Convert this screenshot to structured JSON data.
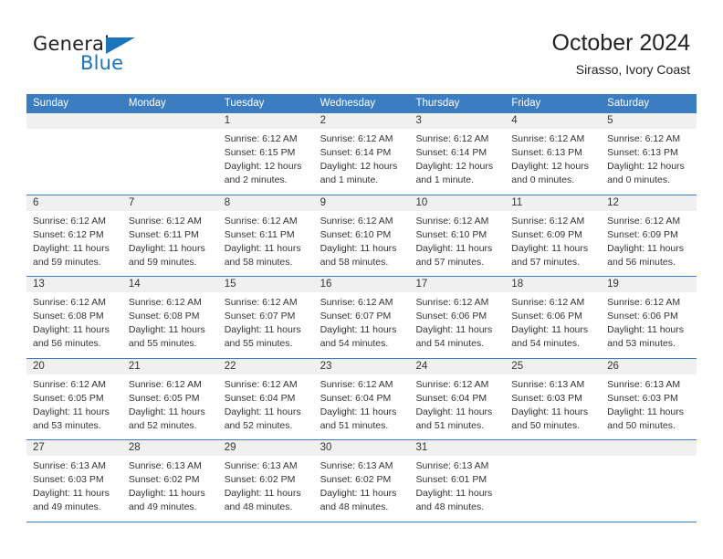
{
  "brand": {
    "name_part1": "General",
    "name_part2": "Blue",
    "accent_color": "#1b75bb"
  },
  "header": {
    "title": "October 2024",
    "subtitle": "Sirasso, Ivory Coast"
  },
  "calendar": {
    "header_bg": "#3b7dc0",
    "weekdays": [
      "Sunday",
      "Monday",
      "Tuesday",
      "Wednesday",
      "Thursday",
      "Friday",
      "Saturday"
    ],
    "weeks": [
      [
        {
          "day": "",
          "sunrise": "",
          "sunset": "",
          "daylight": ""
        },
        {
          "day": "",
          "sunrise": "",
          "sunset": "",
          "daylight": ""
        },
        {
          "day": "1",
          "sunrise": "Sunrise: 6:12 AM",
          "sunset": "Sunset: 6:15 PM",
          "daylight": "Daylight: 12 hours and 2 minutes."
        },
        {
          "day": "2",
          "sunrise": "Sunrise: 6:12 AM",
          "sunset": "Sunset: 6:14 PM",
          "daylight": "Daylight: 12 hours and 1 minute."
        },
        {
          "day": "3",
          "sunrise": "Sunrise: 6:12 AM",
          "sunset": "Sunset: 6:14 PM",
          "daylight": "Daylight: 12 hours and 1 minute."
        },
        {
          "day": "4",
          "sunrise": "Sunrise: 6:12 AM",
          "sunset": "Sunset: 6:13 PM",
          "daylight": "Daylight: 12 hours and 0 minutes."
        },
        {
          "day": "5",
          "sunrise": "Sunrise: 6:12 AM",
          "sunset": "Sunset: 6:13 PM",
          "daylight": "Daylight: 12 hours and 0 minutes."
        }
      ],
      [
        {
          "day": "6",
          "sunrise": "Sunrise: 6:12 AM",
          "sunset": "Sunset: 6:12 PM",
          "daylight": "Daylight: 11 hours and 59 minutes."
        },
        {
          "day": "7",
          "sunrise": "Sunrise: 6:12 AM",
          "sunset": "Sunset: 6:11 PM",
          "daylight": "Daylight: 11 hours and 59 minutes."
        },
        {
          "day": "8",
          "sunrise": "Sunrise: 6:12 AM",
          "sunset": "Sunset: 6:11 PM",
          "daylight": "Daylight: 11 hours and 58 minutes."
        },
        {
          "day": "9",
          "sunrise": "Sunrise: 6:12 AM",
          "sunset": "Sunset: 6:10 PM",
          "daylight": "Daylight: 11 hours and 58 minutes."
        },
        {
          "day": "10",
          "sunrise": "Sunrise: 6:12 AM",
          "sunset": "Sunset: 6:10 PM",
          "daylight": "Daylight: 11 hours and 57 minutes."
        },
        {
          "day": "11",
          "sunrise": "Sunrise: 6:12 AM",
          "sunset": "Sunset: 6:09 PM",
          "daylight": "Daylight: 11 hours and 57 minutes."
        },
        {
          "day": "12",
          "sunrise": "Sunrise: 6:12 AM",
          "sunset": "Sunset: 6:09 PM",
          "daylight": "Daylight: 11 hours and 56 minutes."
        }
      ],
      [
        {
          "day": "13",
          "sunrise": "Sunrise: 6:12 AM",
          "sunset": "Sunset: 6:08 PM",
          "daylight": "Daylight: 11 hours and 56 minutes."
        },
        {
          "day": "14",
          "sunrise": "Sunrise: 6:12 AM",
          "sunset": "Sunset: 6:08 PM",
          "daylight": "Daylight: 11 hours and 55 minutes."
        },
        {
          "day": "15",
          "sunrise": "Sunrise: 6:12 AM",
          "sunset": "Sunset: 6:07 PM",
          "daylight": "Daylight: 11 hours and 55 minutes."
        },
        {
          "day": "16",
          "sunrise": "Sunrise: 6:12 AM",
          "sunset": "Sunset: 6:07 PM",
          "daylight": "Daylight: 11 hours and 54 minutes."
        },
        {
          "day": "17",
          "sunrise": "Sunrise: 6:12 AM",
          "sunset": "Sunset: 6:06 PM",
          "daylight": "Daylight: 11 hours and 54 minutes."
        },
        {
          "day": "18",
          "sunrise": "Sunrise: 6:12 AM",
          "sunset": "Sunset: 6:06 PM",
          "daylight": "Daylight: 11 hours and 54 minutes."
        },
        {
          "day": "19",
          "sunrise": "Sunrise: 6:12 AM",
          "sunset": "Sunset: 6:06 PM",
          "daylight": "Daylight: 11 hours and 53 minutes."
        }
      ],
      [
        {
          "day": "20",
          "sunrise": "Sunrise: 6:12 AM",
          "sunset": "Sunset: 6:05 PM",
          "daylight": "Daylight: 11 hours and 53 minutes."
        },
        {
          "day": "21",
          "sunrise": "Sunrise: 6:12 AM",
          "sunset": "Sunset: 6:05 PM",
          "daylight": "Daylight: 11 hours and 52 minutes."
        },
        {
          "day": "22",
          "sunrise": "Sunrise: 6:12 AM",
          "sunset": "Sunset: 6:04 PM",
          "daylight": "Daylight: 11 hours and 52 minutes."
        },
        {
          "day": "23",
          "sunrise": "Sunrise: 6:12 AM",
          "sunset": "Sunset: 6:04 PM",
          "daylight": "Daylight: 11 hours and 51 minutes."
        },
        {
          "day": "24",
          "sunrise": "Sunrise: 6:12 AM",
          "sunset": "Sunset: 6:04 PM",
          "daylight": "Daylight: 11 hours and 51 minutes."
        },
        {
          "day": "25",
          "sunrise": "Sunrise: 6:13 AM",
          "sunset": "Sunset: 6:03 PM",
          "daylight": "Daylight: 11 hours and 50 minutes."
        },
        {
          "day": "26",
          "sunrise": "Sunrise: 6:13 AM",
          "sunset": "Sunset: 6:03 PM",
          "daylight": "Daylight: 11 hours and 50 minutes."
        }
      ],
      [
        {
          "day": "27",
          "sunrise": "Sunrise: 6:13 AM",
          "sunset": "Sunset: 6:03 PM",
          "daylight": "Daylight: 11 hours and 49 minutes."
        },
        {
          "day": "28",
          "sunrise": "Sunrise: 6:13 AM",
          "sunset": "Sunset: 6:02 PM",
          "daylight": "Daylight: 11 hours and 49 minutes."
        },
        {
          "day": "29",
          "sunrise": "Sunrise: 6:13 AM",
          "sunset": "Sunset: 6:02 PM",
          "daylight": "Daylight: 11 hours and 48 minutes."
        },
        {
          "day": "30",
          "sunrise": "Sunrise: 6:13 AM",
          "sunset": "Sunset: 6:02 PM",
          "daylight": "Daylight: 11 hours and 48 minutes."
        },
        {
          "day": "31",
          "sunrise": "Sunrise: 6:13 AM",
          "sunset": "Sunset: 6:01 PM",
          "daylight": "Daylight: 11 hours and 48 minutes."
        },
        {
          "day": "",
          "sunrise": "",
          "sunset": "",
          "daylight": ""
        },
        {
          "day": "",
          "sunrise": "",
          "sunset": "",
          "daylight": ""
        }
      ]
    ]
  }
}
